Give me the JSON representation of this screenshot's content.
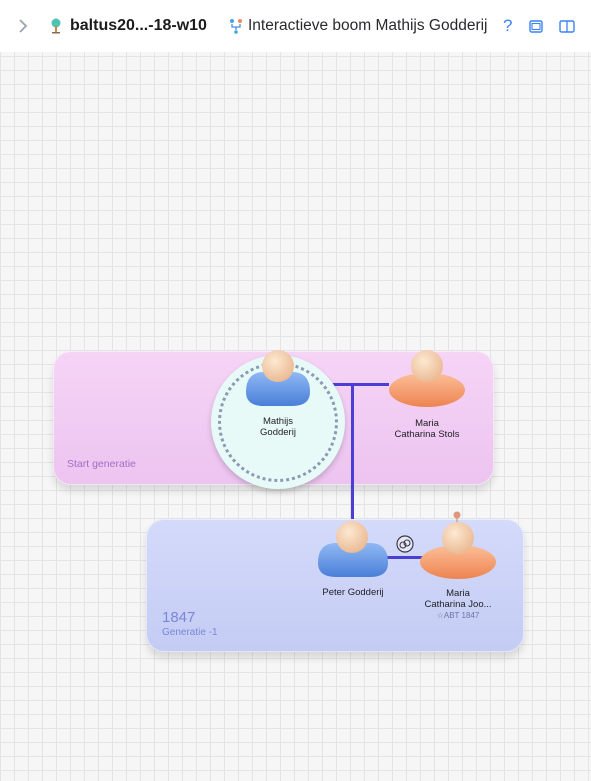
{
  "toolbar": {
    "tree_title": "baltus20...-18-w10",
    "view_title": "Interactieve boom Mathijs Godderij",
    "help_label": "?",
    "icons": [
      "chevron-right-icon",
      "tree-icon",
      "family-tree-icon",
      "help-icon",
      "window-icon",
      "sidebar-icon"
    ]
  },
  "start_generation": {
    "label": "Start generatie",
    "people": [
      {
        "name_line1": "Mathijs",
        "name_line2": "Godderij",
        "gender": "male",
        "focused": true
      },
      {
        "name_line1": "Maria",
        "name_line2": "Catharina Stols",
        "gender": "female",
        "focused": false
      }
    ]
  },
  "generation_minus_1": {
    "year": "1847",
    "label": "Generatie -1",
    "people": [
      {
        "name_line1": "Peter Godderij",
        "name_line2": "",
        "gender": "male"
      },
      {
        "name_line1": "Maria",
        "name_line2": "Catharina Joo...",
        "birth": "☆ABT 1847",
        "gender": "female"
      }
    ]
  },
  "colors": {
    "male_avatar": "#5f95e8",
    "female_avatar": "#f39a6a",
    "connector": "#4a3fd0",
    "start_panel": "#f2cdf4",
    "gen_panel": "#cbd2f8"
  }
}
